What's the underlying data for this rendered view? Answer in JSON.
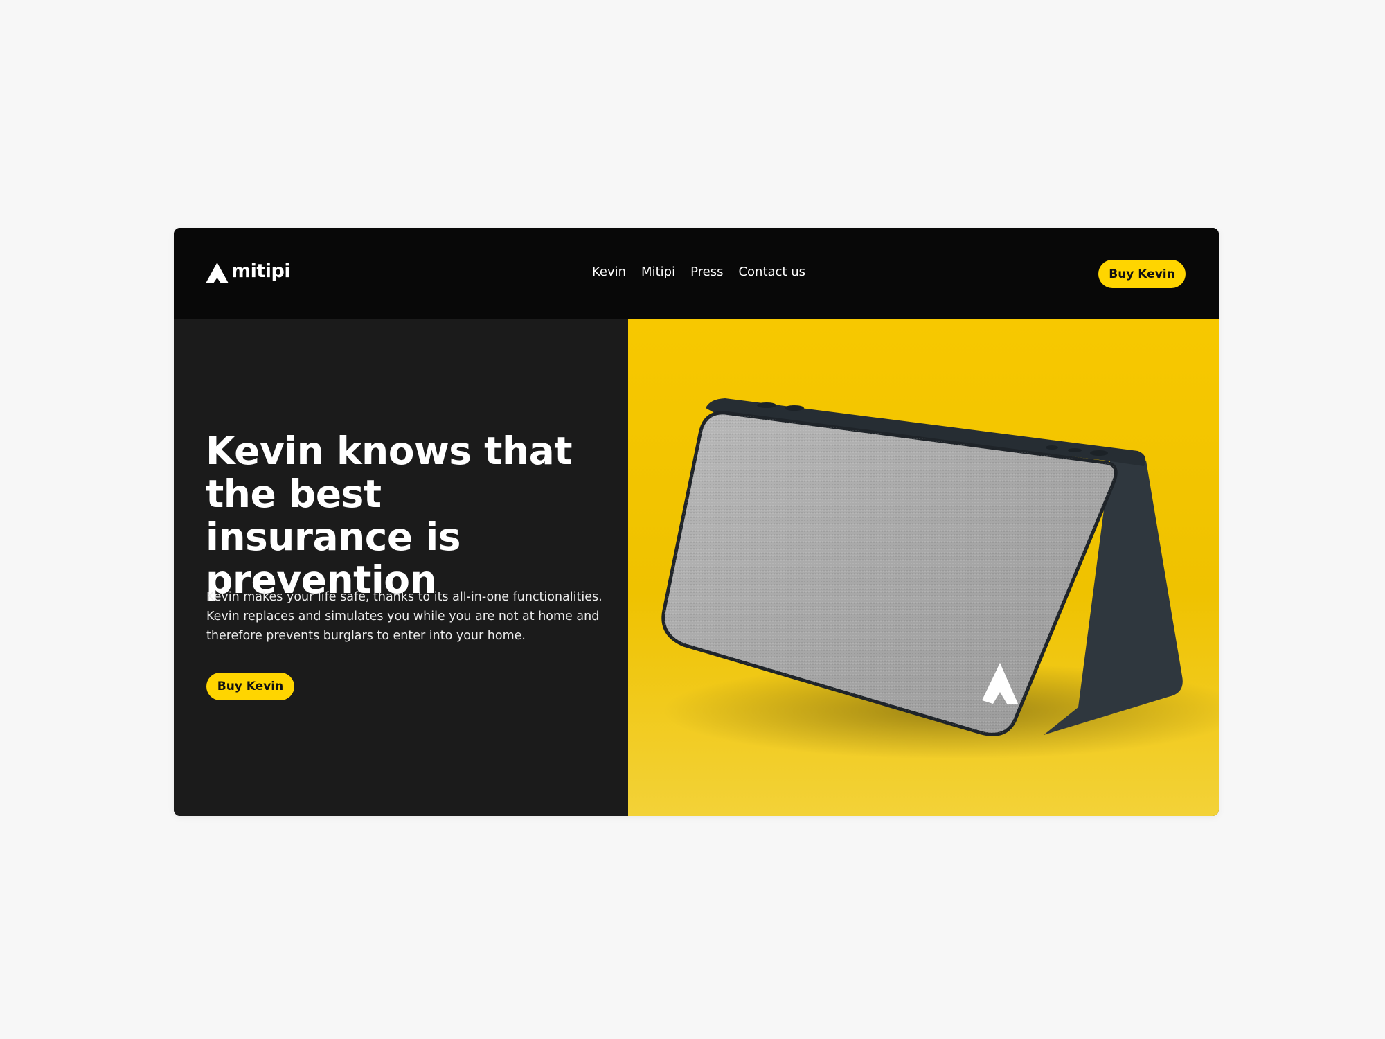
{
  "brand": {
    "name": "mitipi"
  },
  "nav": {
    "items": [
      {
        "label": "Kevin"
      },
      {
        "label": "Mitipi"
      },
      {
        "label": "Press"
      },
      {
        "label": "Contact us"
      }
    ]
  },
  "header": {
    "cta_label": "Buy Kevin"
  },
  "hero": {
    "headline": "Kevin knows that the best insurance is prevention",
    "body": "Kevin makes your life safe, thanks to its all-in-one functionalities. Kevin replaces and simulates you while you are not at home and therefore prevents burglars to enter into your home.",
    "cta_label": "Buy Kevin",
    "image": {
      "subject": "Kevin device on yellow background",
      "icon": "mitipi-logo-icon"
    }
  },
  "colors": {
    "accent": "#ffd500",
    "topbar": "#080808",
    "hero_left": "#1b1b1b",
    "page": "#f7f7f7"
  }
}
